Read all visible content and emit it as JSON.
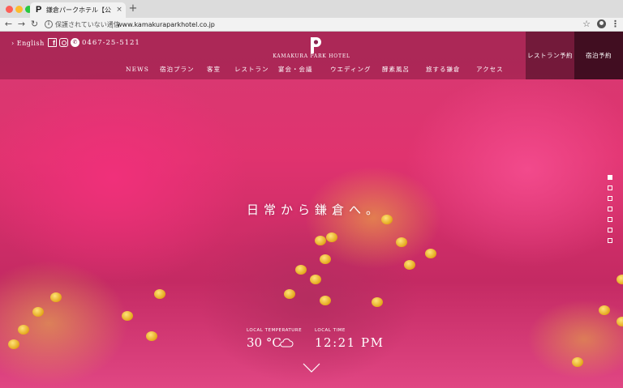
{
  "browser": {
    "tab_title": "鎌倉パークホテル【公式】| KAMAKURA PARK HOTEL",
    "tab_favicon": "P",
    "tab_close": "×",
    "new_tab": "+",
    "security_text": "保護されていない通信",
    "url": "www.kamakuraparkhotel.co.jp",
    "icons": [
      "back-arrow-icon",
      "forward-arrow-icon",
      "reload-icon",
      "info-icon",
      "star-icon",
      "profile-icon",
      "menu-icon"
    ]
  },
  "header": {
    "english_link": "› English",
    "phone": "0467-25-5121",
    "logo_text": "KAMAKURA PARK HOTEL",
    "nav": [
      "NEWS",
      "宿泊プラン",
      "客室",
      "レストラン",
      "宴会・会議",
      "ウエディング",
      "酵素風呂",
      "旅する鎌倉",
      "アクセス"
    ],
    "restaurant_button": "レストラン予約",
    "stay_button": "宿泊予約"
  },
  "hero": {
    "tagline": "日常から鎌倉へ。",
    "temperature_label": "LOCAL TEMPERATURE",
    "temperature_value": "30 °C",
    "time_label": "LOCAL TIME",
    "time_value": "12:21 PM",
    "slide_count": 7,
    "active_slide": 1
  },
  "colors": {
    "header_overlay": "#78143780",
    "restaurant_button_bg": "#460f23",
    "stay_button_bg": "#1e050f",
    "flower_pink": "#e0336f",
    "stamen_yellow": "#e3a71a"
  }
}
